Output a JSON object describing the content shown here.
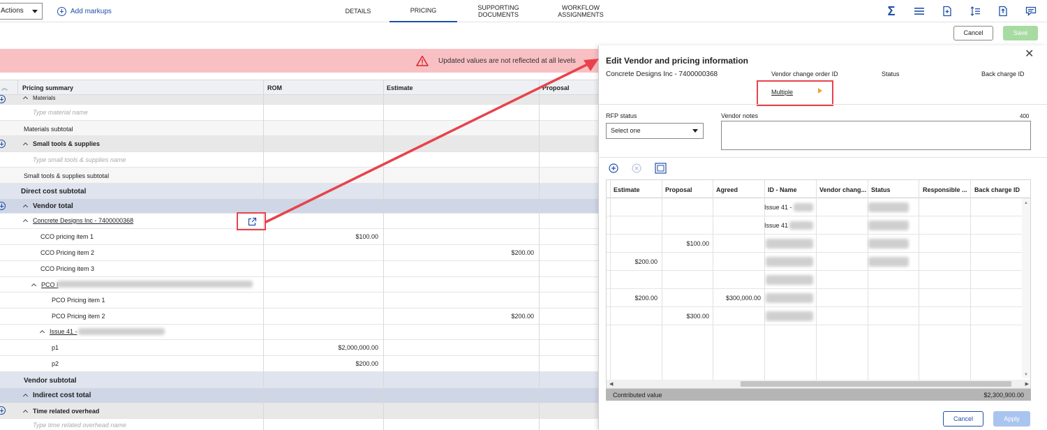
{
  "toolbar": {
    "actions_label": "Actions",
    "add_markups_label": "Add markups",
    "cancel_label": "Cancel",
    "save_label": "Save"
  },
  "tabs": [
    {
      "label": "DETAILS"
    },
    {
      "label": "PRICING"
    },
    {
      "label": "SUPPORTING DOCUMENTS"
    },
    {
      "label": "WORKFLOW ASSIGNMENTS"
    }
  ],
  "tool_icons": [
    "sigma-icon",
    "list-icon",
    "document-add-icon",
    "sort-icon",
    "document-export-icon",
    "comment-icon"
  ],
  "alert": {
    "text": "Updated values are not reflected at all levels"
  },
  "grid": {
    "columns": [
      "Pricing summary",
      "ROM",
      "Estimate",
      "Proposal"
    ],
    "rows": [
      {
        "label": "Materials",
        "kind": "group"
      },
      {
        "label": "Type material name",
        "kind": "placeholder"
      },
      {
        "label": "Materials subtotal",
        "kind": "subtotal"
      },
      {
        "label": "Small tools & supplies",
        "kind": "group"
      },
      {
        "label": "Type small tools & supplies name",
        "kind": "placeholder"
      },
      {
        "label": "Small tools & supplies subtotal",
        "kind": "subtotal"
      },
      {
        "label": "Direct cost subtotal",
        "kind": "section"
      },
      {
        "label": "Vendor total",
        "kind": "section2"
      },
      {
        "label": "Concrete Designs Inc - 7400000368",
        "kind": "vendor"
      },
      {
        "label": "CCO pricing item 1",
        "rom": "$100.00"
      },
      {
        "label": "CCO Pricing item 2",
        "estimate": "$200.00"
      },
      {
        "label": "CCO Pricing item 3"
      },
      {
        "label": "PCO I",
        "kind": "pco"
      },
      {
        "label": "PCO Pricing item 1"
      },
      {
        "label": "PCO Pricing item 2",
        "estimate": "$200.00"
      },
      {
        "label": "Issue 41 -",
        "kind": "issue"
      },
      {
        "label": "p1",
        "rom": "$2,000,000.00"
      },
      {
        "label": "p2",
        "rom": "$200.00"
      },
      {
        "label": "Vendor subtotal",
        "kind": "section"
      },
      {
        "label": "Indirect cost total",
        "kind": "section2"
      },
      {
        "label": "Time related overhead",
        "kind": "group"
      },
      {
        "label": "Type time related overhead name",
        "kind": "placeholder"
      }
    ]
  },
  "panel": {
    "title": "Edit Vendor and pricing information",
    "vendor_name": "Concrete Designs Inc - 7400000368",
    "vendor_change_order_label": "Vendor change order ID",
    "status_label": "Status",
    "back_charge_label": "Back charge ID",
    "multiple_link": "Multiple",
    "rfp_status_label": "RFP status",
    "rfp_select_value": "Select one",
    "vendor_notes_label": "Vendor notes",
    "notes_counter": "400",
    "table": {
      "columns": [
        "Estimate",
        "Proposal",
        "Agreed",
        "ID - Name",
        "Vendor chang...",
        "Status",
        "Responsible ...",
        "Back charge ID"
      ],
      "rows": [
        {
          "estimate": "",
          "proposal": "",
          "agreed": "",
          "id_name": "Issue 41 -"
        },
        {
          "estimate": "",
          "proposal": "",
          "agreed": "",
          "id_name": "Issue 41"
        },
        {
          "estimate": "",
          "proposal": "$100.00",
          "agreed": "",
          "id_name": ""
        },
        {
          "estimate": "$200.00",
          "proposal": "",
          "agreed": "",
          "id_name": ""
        },
        {
          "estimate": "",
          "proposal": "",
          "agreed": "",
          "id_name": ""
        },
        {
          "estimate": "$200.00",
          "proposal": "",
          "agreed": "$300,000.00",
          "id_name": ""
        },
        {
          "estimate": "",
          "proposal": "$300.00",
          "agreed": "",
          "id_name": ""
        }
      ]
    },
    "contributed_label": "Contributed value",
    "contributed_value": "$2,300,900.00",
    "cancel_label": "Cancel",
    "apply_label": "Apply"
  }
}
